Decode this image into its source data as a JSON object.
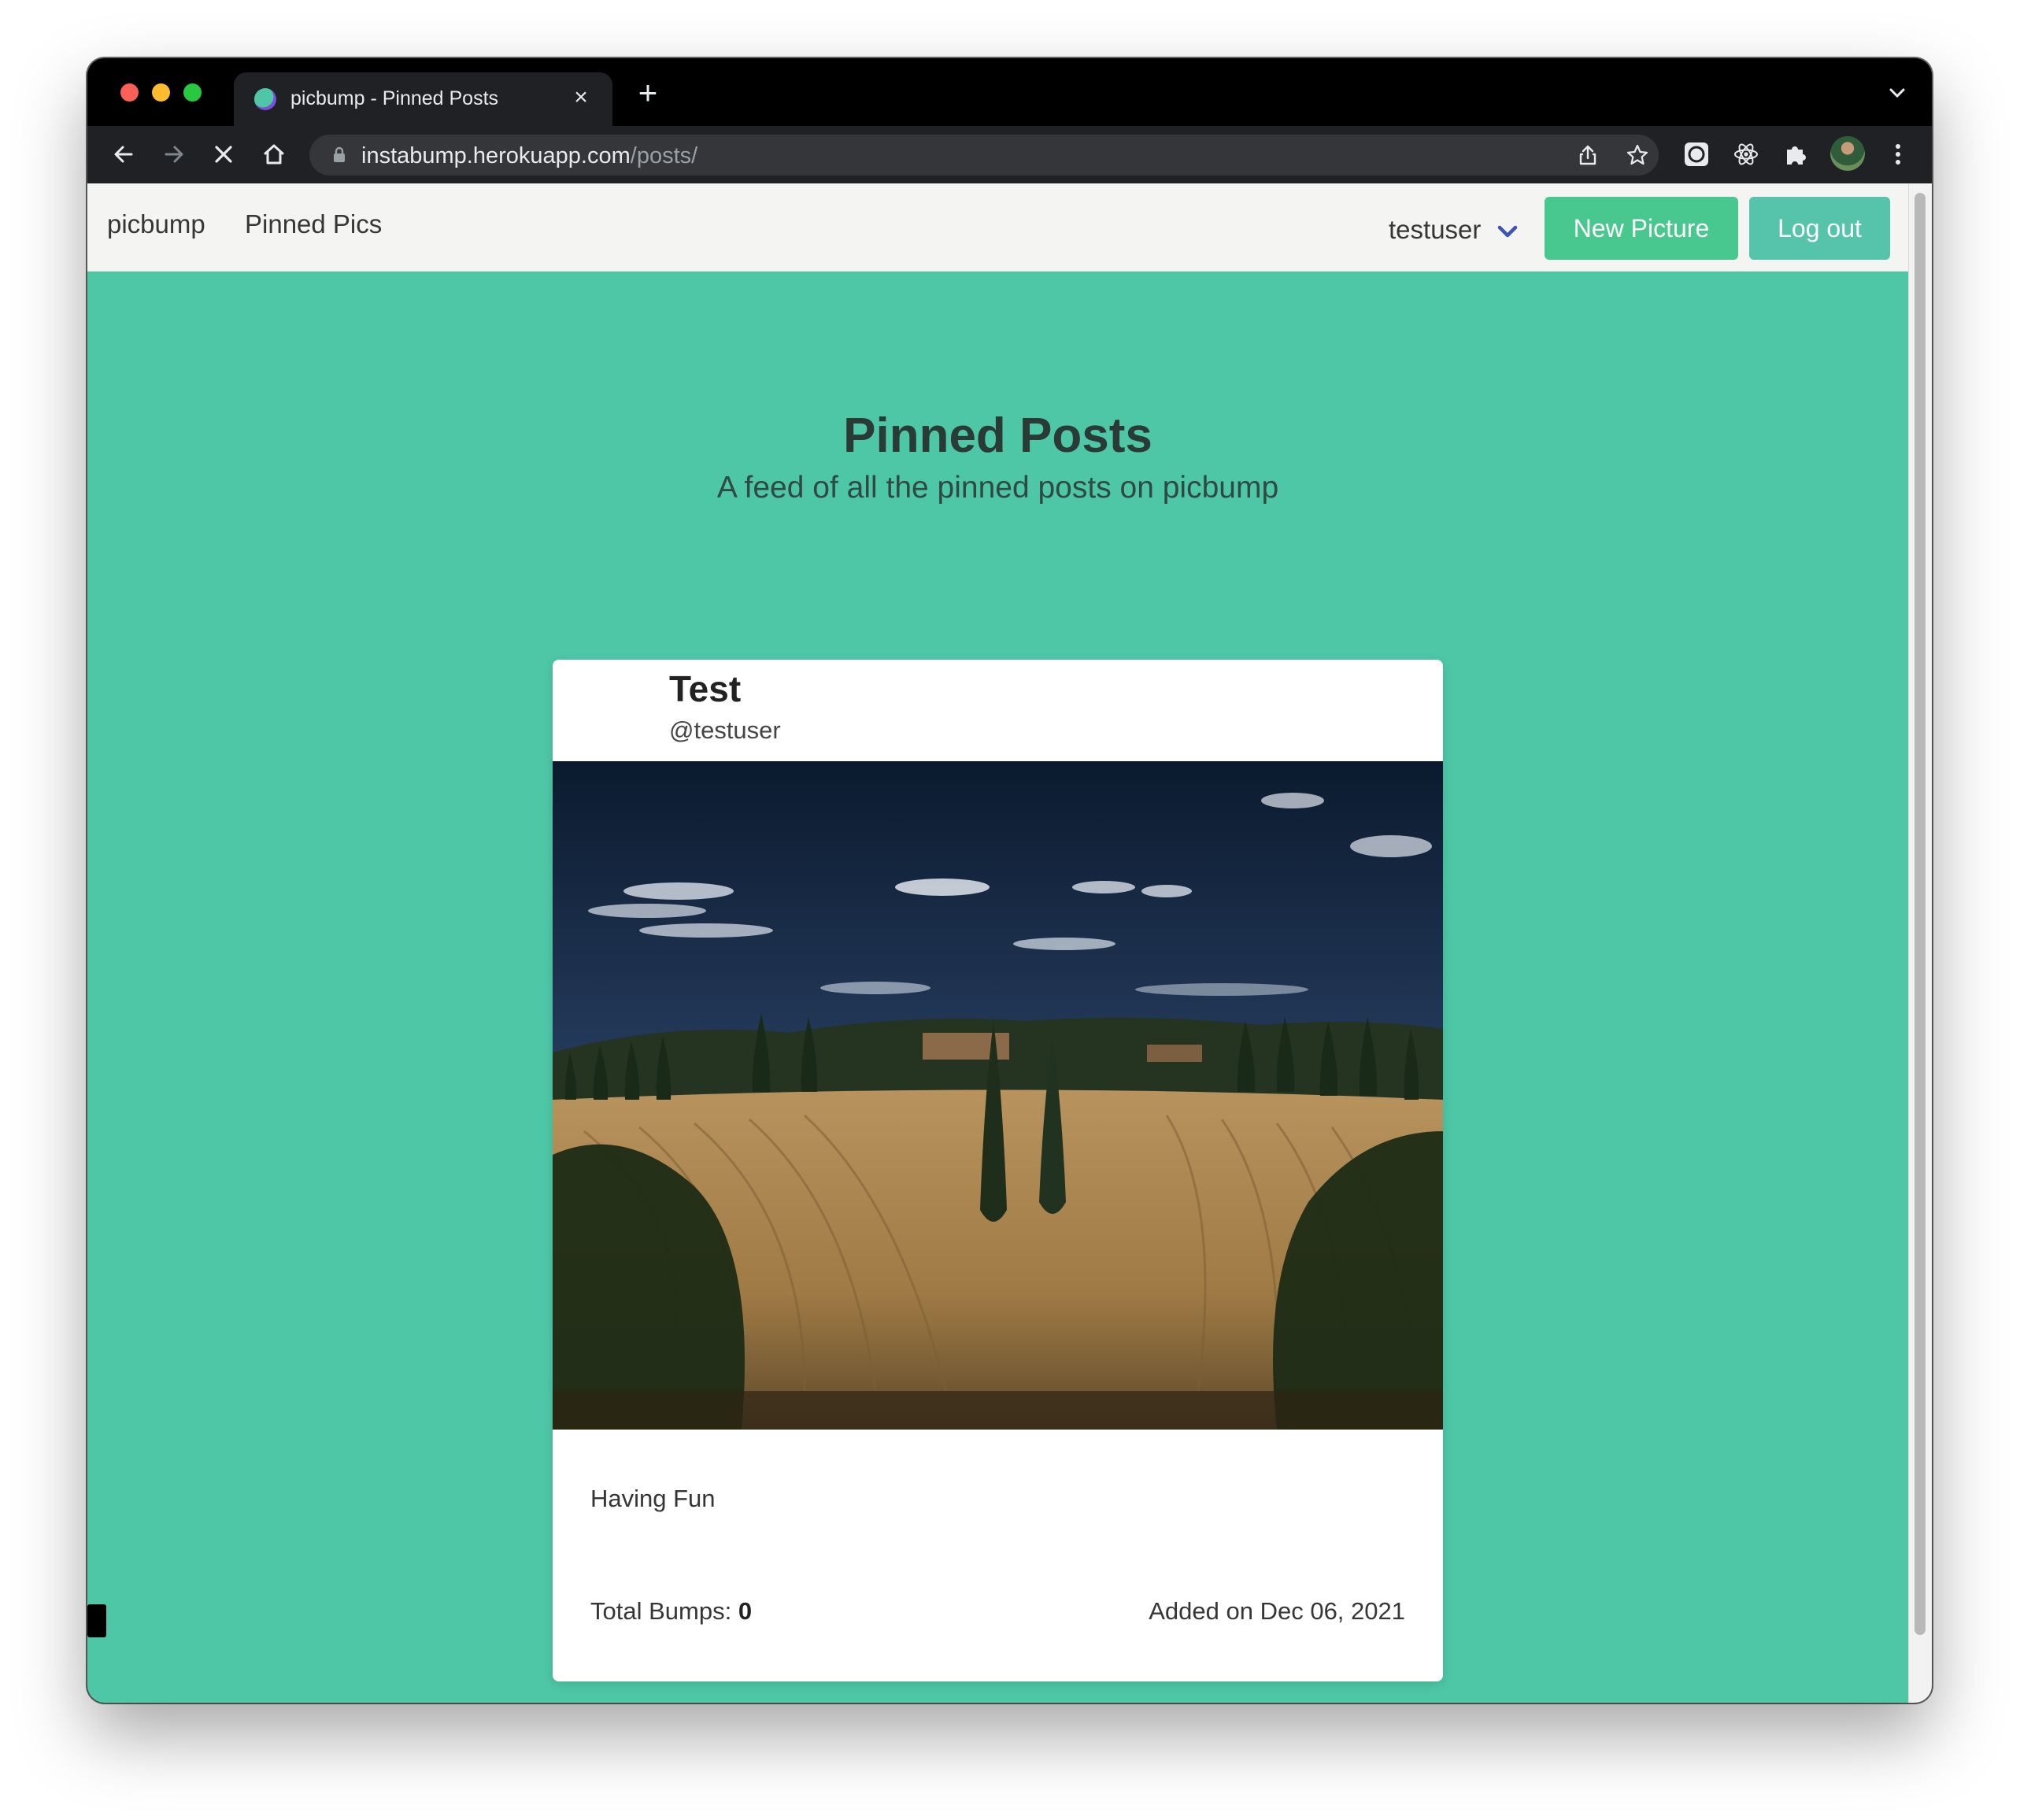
{
  "browser": {
    "tab_title": "picbump - Pinned Posts",
    "tab_close": "×",
    "new_tab": "+",
    "url_host": "instabump.herokuapp.com",
    "url_path": "/posts/"
  },
  "navbar": {
    "brand": "picbump",
    "pinned_pics": "Pinned Pics",
    "username": "testuser",
    "new_picture": "New Picture",
    "log_out": "Log out"
  },
  "hero": {
    "title": "Pinned Posts",
    "subtitle": "A feed of all the pinned posts on picbump"
  },
  "post": {
    "title": "Test",
    "author": "@testuser",
    "caption": "Having Fun",
    "bumps_label": "Total Bumps:",
    "bumps_value": "0",
    "added": "Added on Dec 06, 2021"
  },
  "colors": {
    "page_background": "#4ec7a6",
    "primary_button": "#48c78e",
    "navbar_background": "#f4f4f2"
  }
}
